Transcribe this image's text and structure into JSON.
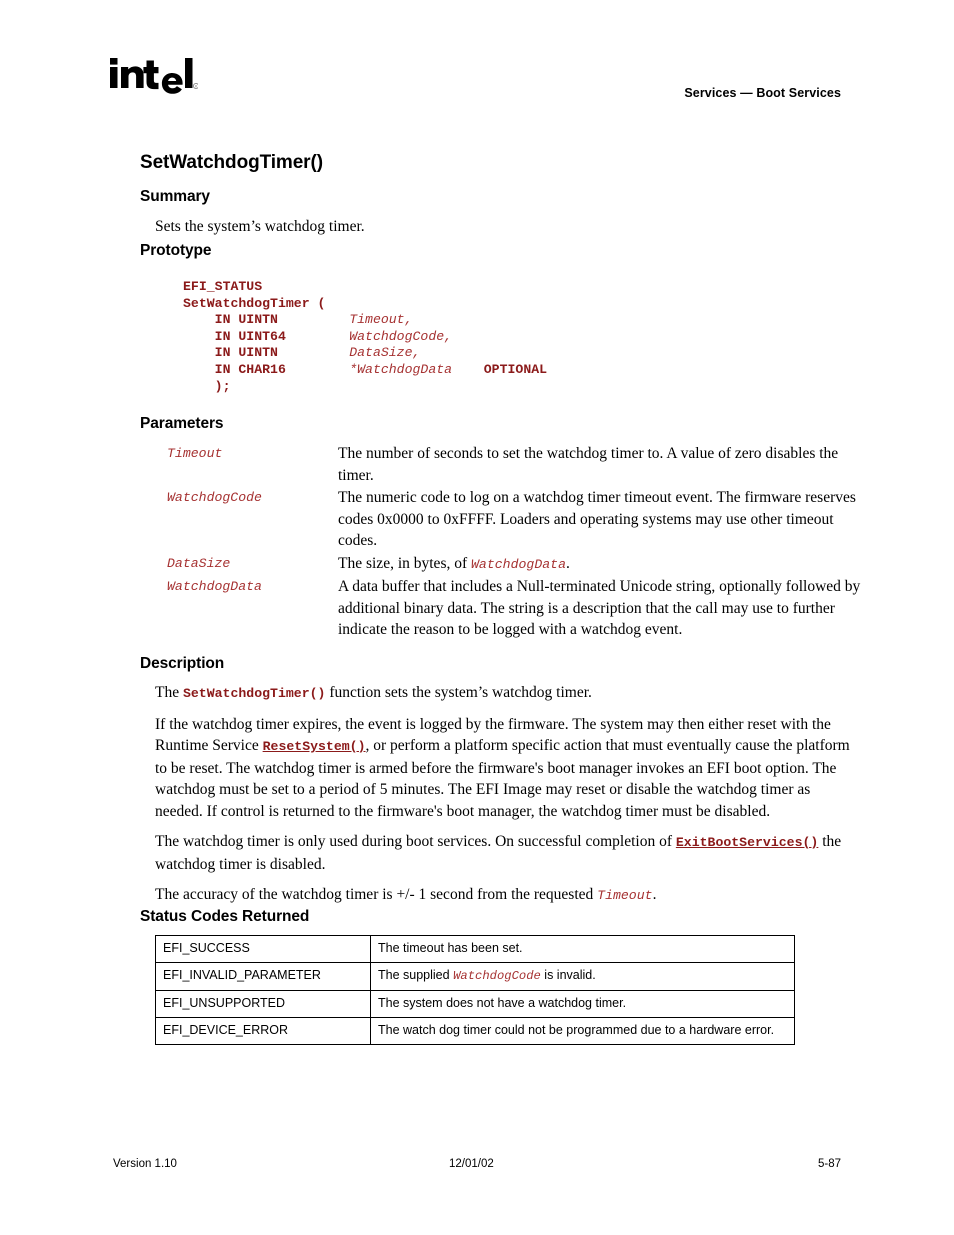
{
  "header": {
    "logo_alt": "intel-logo",
    "running_head": "Services — Boot Services"
  },
  "page_title": "SetWatchdogTimer()",
  "sections": {
    "summary": {
      "heading": "Summary",
      "text": "Sets the system’s watchdog timer."
    },
    "prototype": {
      "heading": "Prototype",
      "lines": [
        {
          "type": "kw",
          "text": "EFI_STATUS"
        },
        {
          "type": "kw",
          "text": "SetWatchdogTimer ("
        },
        {
          "type": "param",
          "keyword": "IN UINTN",
          "name": "Timeout,"
        },
        {
          "type": "param",
          "keyword": "IN UINT64",
          "name": "WatchdogCode,"
        },
        {
          "type": "param",
          "keyword": "IN UINTN",
          "name": "DataSize,"
        },
        {
          "type": "param",
          "keyword": "IN CHAR16",
          "name": "*WatchdogData",
          "trailing": "OPTIONAL"
        },
        {
          "type": "kw",
          "text": ");"
        }
      ],
      "code_block_text": "EFI_STATUS\nSetWatchdogTimer (\n    IN UINTN         Timeout,\n    IN UINT64        WatchdogCode,\n    IN UINTN         DataSize,\n    IN CHAR16        *WatchdogData    OPTIONAL\n    );"
    },
    "parameters": {
      "heading": "Parameters",
      "items": [
        {
          "name": "Timeout",
          "description": "The number of seconds to set the watchdog timer to.  A value of zero disables the timer."
        },
        {
          "name": "WatchdogCode",
          "description": "The numeric code to log on a watchdog timer timeout event.  The firmware reserves codes 0x0000 to 0xFFFF.  Loaders and operating systems may use other timeout codes."
        },
        {
          "name": "DataSize",
          "desc_before": "The size, in bytes, of ",
          "desc_code": "WatchdogData",
          "desc_after": "."
        },
        {
          "name": "WatchdogData",
          "description": "A data buffer that includes a Null-terminated Unicode string, optionally followed by additional binary data.  The string is a description that the call may use to further indicate the reason to be logged with a watchdog event."
        }
      ]
    },
    "description": {
      "heading": "Description",
      "p1_before": "The ",
      "p1_code": "SetWatchdogTimer()",
      "p1_after": " function sets the system’s watchdog timer.",
      "p2_before": "If the watchdog timer expires, the event is logged by the firmware.  The system may then either reset with the Runtime Service ",
      "p2_link": "ResetSystem()",
      "p2_after": ", or perform a platform specific action that must eventually cause the platform to be reset.  The watchdog timer is armed before the firmware's boot manager invokes an EFI boot option.  The watchdog must be set to a period of 5 minutes.  The EFI Image may reset or disable the watchdog timer as needed.  If control is returned to the firmware's boot manager, the watchdog timer must be disabled.",
      "p3_before": "The watchdog timer is only used during boot services.  On successful completion of ",
      "p3_link": "ExitBootServices()",
      "p3_after": " the watchdog timer is disabled.",
      "p4_before": "The accuracy of the watchdog timer is +/- 1 second from the requested ",
      "p4_code": "Timeout",
      "p4_after": "."
    },
    "status_codes": {
      "heading": "Status Codes Returned",
      "rows": [
        {
          "code": "EFI_SUCCESS",
          "description": "The timeout has been set."
        },
        {
          "code": "EFI_INVALID_PARAMETER",
          "desc_before": "The supplied ",
          "desc_code": "WatchdogCode",
          "desc_after": " is invalid."
        },
        {
          "code": "EFI_UNSUPPORTED",
          "description": "The system does not have a watchdog timer."
        },
        {
          "code": "EFI_DEVICE_ERROR",
          "description": "The watch dog timer could not be programmed due to a hardware error."
        }
      ]
    }
  },
  "footer": {
    "version": "Version 1.10",
    "date": "12/01/02",
    "page_number": "5-87"
  },
  "colors": {
    "code_red": "#8B1A1A",
    "param_red": "#A63232",
    "text": "#000000",
    "background": "#FFFFFF"
  }
}
